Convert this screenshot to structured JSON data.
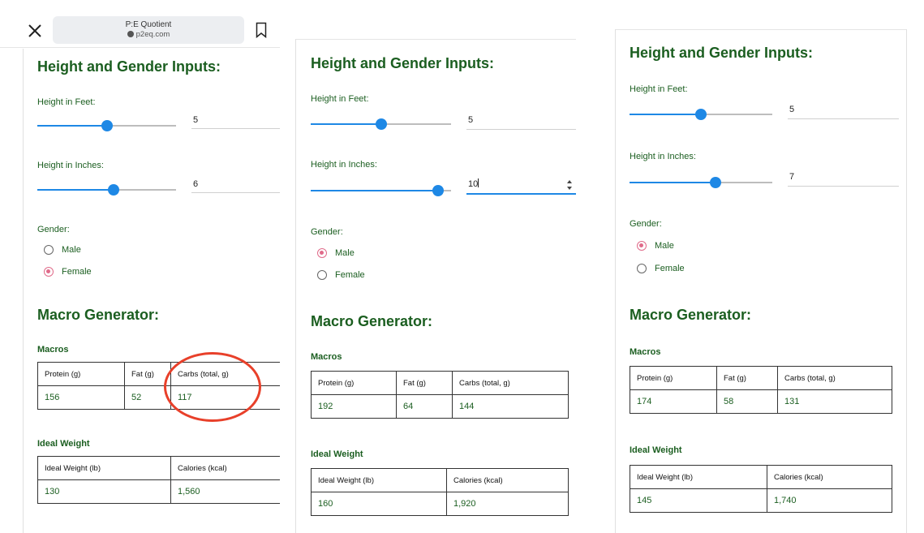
{
  "browser": {
    "title": "P:E Quotient",
    "url": "p2eq.com",
    "close_icon": "close-icon",
    "bookmark_icon": "bookmark-icon"
  },
  "labels": {
    "section_height": "Height and Gender Inputs:",
    "feet": "Height in Feet:",
    "inches": "Height in Inches:",
    "gender": "Gender:",
    "male": "Male",
    "female": "Female",
    "section_macro": "Macro Generator:",
    "macros": "Macros",
    "ideal_weight": "Ideal Weight",
    "protein": "Protein (g)",
    "fat": "Fat (g)",
    "carbs": "Carbs (total, g)",
    "ideal_weight_lb": "Ideal Weight (lb)",
    "calories": "Calories (kcal)"
  },
  "panels": [
    {
      "feet": "5",
      "feet_level": 0.5,
      "inches": "6",
      "inches_level": 0.55,
      "gender": "Female",
      "protein": "156",
      "fat": "52",
      "carbs": "117",
      "ideal_weight": "130",
      "calories": "1,560"
    },
    {
      "feet": "5",
      "feet_level": 0.5,
      "inches": "10",
      "inches_level": 0.91,
      "gender": "Male",
      "protein": "192",
      "fat": "64",
      "carbs": "144",
      "ideal_weight": "160",
      "calories": "1,920"
    },
    {
      "feet": "5",
      "feet_level": 0.5,
      "inches": "7",
      "inches_level": 0.6,
      "gender": "Male",
      "protein": "174",
      "fat": "58",
      "carbs": "131",
      "ideal_weight": "145",
      "calories": "1,740"
    }
  ],
  "colors": {
    "accent": "#1e88e5",
    "heading": "#1b5e20",
    "radio_checked": "#e06b8a",
    "annotation": "#e8402a"
  }
}
